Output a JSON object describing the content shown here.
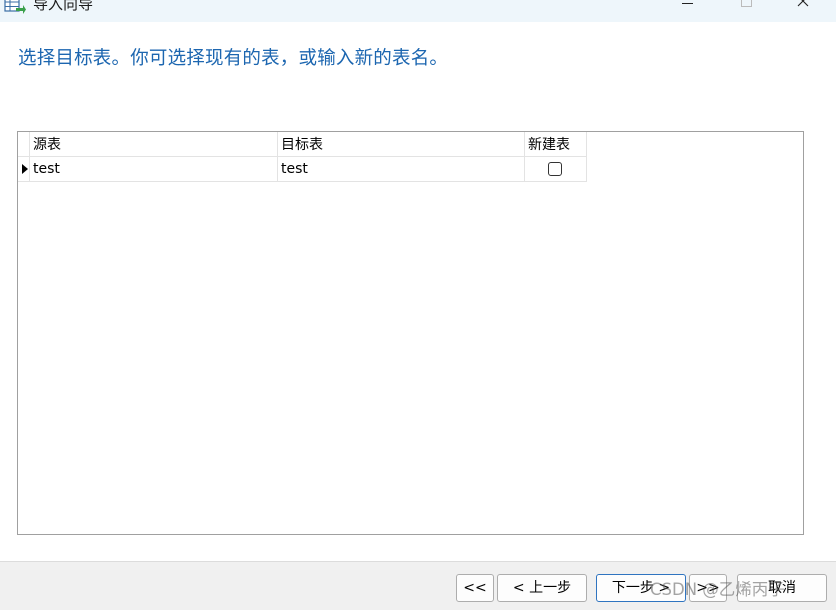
{
  "window": {
    "title": "导入向导",
    "icon": "import-wizard-icon",
    "controls": [
      "minimize-icon",
      "maximize-icon",
      "close-icon"
    ]
  },
  "instruction": "选择目标表。你可选择现有的表，或输入新的表名。",
  "grid": {
    "columns": [
      "源表",
      "目标表",
      "新建表"
    ],
    "rows": [
      {
        "source": "test",
        "target": "test",
        "new_table": false
      }
    ]
  },
  "buttons": {
    "first": "<<",
    "prev": "< 上一步",
    "next": "下一步 >",
    "last": ">>",
    "cancel": "取消"
  },
  "watermark": "CSDN @乙烯丙子",
  "colors": {
    "title_bar": "#eef6fb",
    "instruction_text": "#1c66b0",
    "footer": "#f0f0f0",
    "default_button_border": "#2f74c0"
  }
}
